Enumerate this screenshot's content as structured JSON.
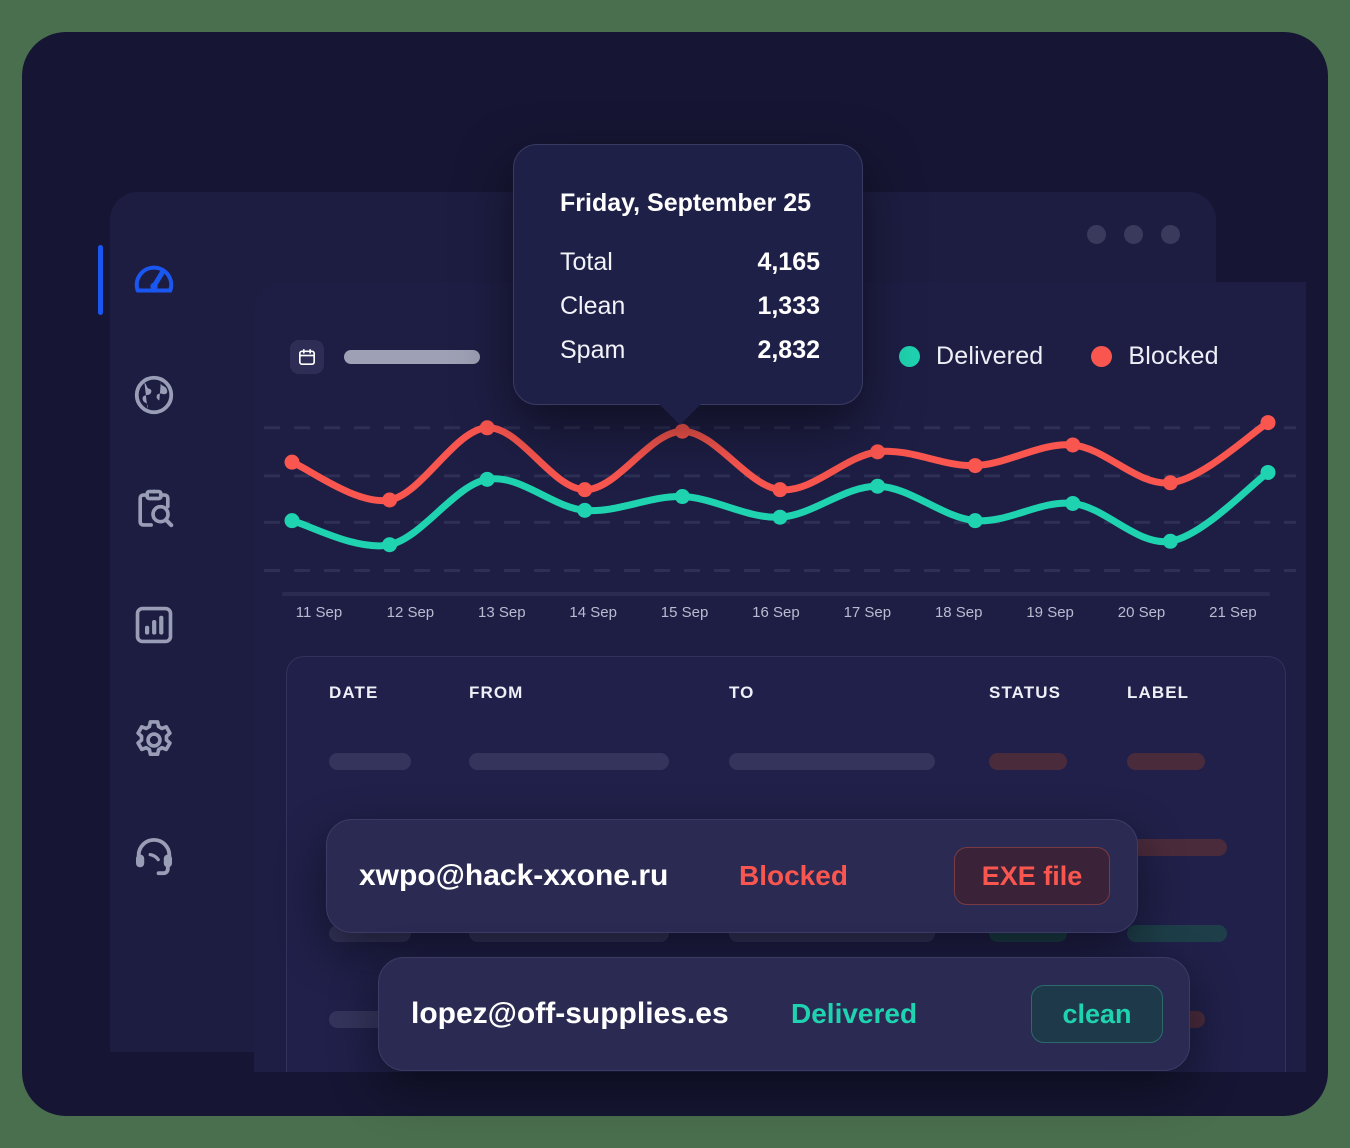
{
  "colors": {
    "page_background": "#4a6f4e",
    "frame": "#161634",
    "panel": "#1e1e45",
    "accent_blue": "#1a56f0",
    "delivered": "#1fd3b0",
    "blocked": "#f9564f"
  },
  "sidebar": {
    "items": [
      {
        "icon": "gauge-icon",
        "name": "dashboard",
        "active": true
      },
      {
        "icon": "globe-icon",
        "name": "network",
        "active": false
      },
      {
        "icon": "clipboard-search-icon",
        "name": "audit-log",
        "active": false
      },
      {
        "icon": "bar-chart-icon",
        "name": "reports",
        "active": false
      },
      {
        "icon": "gear-icon",
        "name": "settings",
        "active": false
      },
      {
        "icon": "headset-icon",
        "name": "support",
        "active": false
      }
    ]
  },
  "toolbar": {
    "calendar_icon": "calendar-icon",
    "date_range_placeholder": ""
  },
  "tooltip": {
    "title": "Friday, September 25",
    "rows": [
      {
        "key": "Total",
        "value": "4,165"
      },
      {
        "key": "Clean",
        "value": "1,333"
      },
      {
        "key": "Spam",
        "value": "2,832"
      }
    ]
  },
  "chart_data": {
    "type": "line",
    "title": "",
    "xlabel": "",
    "ylabel": "",
    "grid": true,
    "legend_position": "top-right",
    "categories": [
      "11 Sep",
      "12 Sep",
      "13 Sep",
      "14 Sep",
      "15 Sep",
      "16 Sep",
      "17 Sep",
      "18 Sep",
      "19 Sep",
      "20 Sep",
      "21 Sep"
    ],
    "ylim": [
      0,
      100
    ],
    "series": [
      {
        "name": "Delivered",
        "color": "#1fd3b0",
        "values": [
          38,
          24,
          62,
          44,
          52,
          40,
          58,
          38,
          48,
          26,
          66
        ]
      },
      {
        "name": "Blocked",
        "color": "#f9564f",
        "values": [
          72,
          50,
          92,
          56,
          90,
          56,
          78,
          70,
          82,
          60,
          95
        ]
      }
    ]
  },
  "legend": [
    {
      "label": "Delivered",
      "color": "#1fd3b0"
    },
    {
      "label": "Blocked",
      "color": "#f9564f"
    }
  ],
  "table": {
    "columns": [
      "DATE",
      "FROM",
      "TO",
      "STATUS",
      "LABEL"
    ]
  },
  "rows": [
    {
      "email": "xwpo@hack-xxone.ru",
      "status": "Blocked",
      "badge": "EXE file",
      "status_color": "#f9564f"
    },
    {
      "email": "lopez@off-supplies.es",
      "status": "Delivered",
      "badge": "clean",
      "status_color": "#1fd3b0"
    }
  ]
}
